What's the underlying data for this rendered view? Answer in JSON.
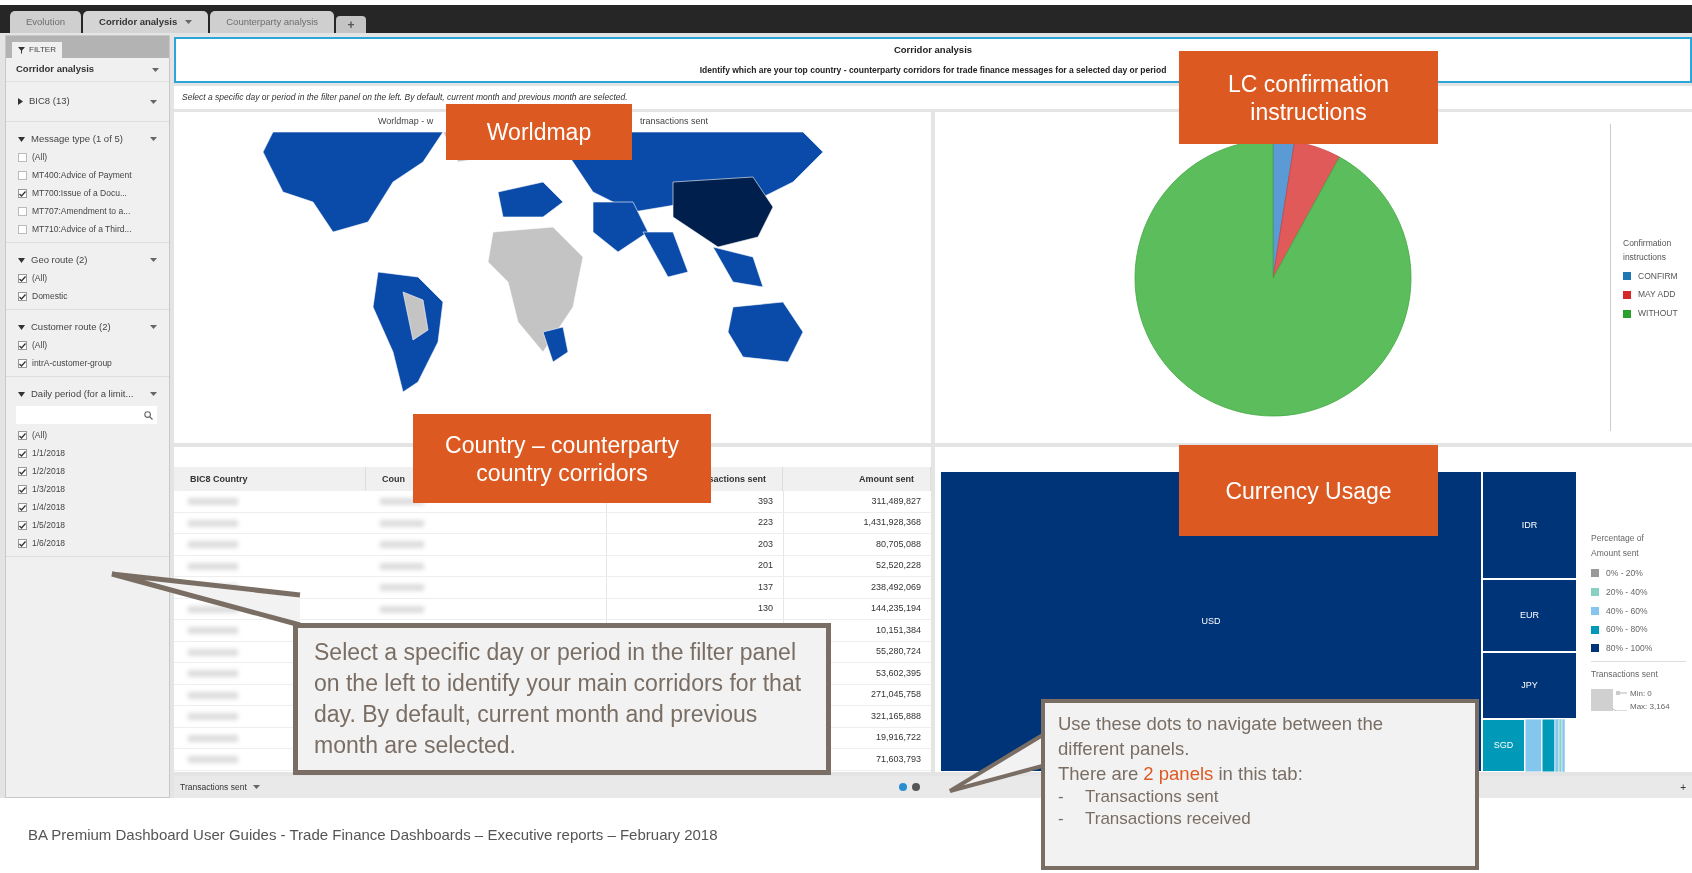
{
  "tabs": [
    {
      "label": "Evolution",
      "selected": false,
      "menu": false
    },
    {
      "label": "Corridor analysis",
      "selected": true,
      "menu": true
    },
    {
      "label": "Counterparty analysis",
      "selected": false,
      "menu": false
    }
  ],
  "add_tab": "+",
  "filter_panel": {
    "tab": "FILTER",
    "title": "Corridor analysis",
    "collapsed_section": "BIC8 (13)",
    "sections": [
      {
        "title": "Message type (1 of 5)",
        "search": false,
        "items": [
          {
            "label": "(All)",
            "checked": false
          },
          {
            "label": "MT400:Advice of Payment",
            "checked": false
          },
          {
            "label": "MT700:Issue of a Docu...",
            "checked": true
          },
          {
            "label": "MT707:Amendment to a...",
            "checked": false
          },
          {
            "label": "MT710:Advice of a Third...",
            "checked": false
          }
        ]
      },
      {
        "title": "Geo route (2)",
        "search": false,
        "items": [
          {
            "label": "(All)",
            "checked": true
          },
          {
            "label": "Domestic",
            "checked": true
          }
        ]
      },
      {
        "title": "Customer route (2)",
        "search": false,
        "items": [
          {
            "label": "(All)",
            "checked": true
          },
          {
            "label": "intrA-customer-group",
            "checked": true
          }
        ]
      },
      {
        "title": "Daily period (for a limit...",
        "search": true,
        "items": [
          {
            "label": "(All)",
            "checked": true
          },
          {
            "label": "1/1/2018",
            "checked": true
          },
          {
            "label": "1/2/2018",
            "checked": true
          },
          {
            "label": "1/3/2018",
            "checked": true
          },
          {
            "label": "1/4/2018",
            "checked": true
          },
          {
            "label": "1/5/2018",
            "checked": true
          },
          {
            "label": "1/6/2018",
            "checked": true
          }
        ]
      }
    ]
  },
  "header": {
    "title": "Corridor analysis",
    "description": "Identify which are your top country - counterparty corridors for trade finance messages for a selected day or period",
    "subtitle": "Select a specific day or period in the filter panel on the left. By default, current month and previous month are selected."
  },
  "map_panel": {
    "title_start": "Worldmap - w",
    "title_end": "transactions sent"
  },
  "pie_panel": {
    "legend_title": "Confirmation instructions",
    "legend": [
      {
        "label": "CONFIRM",
        "color": "#1f77b4"
      },
      {
        "label": "MAY ADD",
        "color": "#d62728"
      },
      {
        "label": "WITHOUT",
        "color": "#2ca02c"
      }
    ]
  },
  "table": {
    "columns": [
      "BIC8 Country",
      "Coun",
      "sactions sent",
      "Amount sent"
    ],
    "rows": [
      {
        "transactions": "393",
        "amount": "311,489,827"
      },
      {
        "transactions": "223",
        "amount": "1,431,928,368"
      },
      {
        "transactions": "203",
        "amount": "80,705,088"
      },
      {
        "transactions": "201",
        "amount": "52,520,228"
      },
      {
        "transactions": "137",
        "amount": "238,492,069"
      },
      {
        "transactions": "130",
        "amount": "144,235,194"
      },
      {
        "amount": "10,151,384"
      },
      {
        "amount": "55,280,724"
      },
      {
        "amount": "53,602,395"
      },
      {
        "amount": "271,045,758"
      },
      {
        "amount": "321,165,888"
      },
      {
        "amount": "19,916,722"
      },
      {
        "amount": "71,603,793"
      }
    ]
  },
  "treemap": {
    "cells": [
      {
        "label": "USD",
        "color": "#003478"
      },
      {
        "label": "IDR",
        "color": "#003478"
      },
      {
        "label": "EUR",
        "color": "#003478"
      },
      {
        "label": "JPY",
        "color": "#003478"
      },
      {
        "label": "SGD",
        "color": "#0099b8"
      }
    ],
    "legend_title": "Percentage of Amount sent",
    "legend": [
      {
        "label": "0% - 20%",
        "color": "#999999"
      },
      {
        "label": "20% - 40%",
        "color": "#88d0c4"
      },
      {
        "label": "40% - 60%",
        "color": "#85c6ef"
      },
      {
        "label": "60% - 80%",
        "color": "#0099b8"
      },
      {
        "label": "80% - 100%",
        "color": "#003478"
      }
    ],
    "size_title": "Transactions sent",
    "size_min": "Min: 0",
    "size_max": "Max: 3,164"
  },
  "bottom_bar": {
    "measure": "Transactions sent",
    "dots": [
      {
        "selected": true
      },
      {
        "selected": false
      }
    ],
    "add": "+"
  },
  "labels": [
    "Worldmap",
    "LC confirmation instructions",
    "Country – counterparty country corridors",
    "Currency Usage"
  ],
  "callout_filter": "Select a specific day or period in the filter panel on the left to identify your main corridors for that day. By default, current month and previous month are selected.",
  "callout_dots": {
    "intro": "Use these dots to navigate between the different panels.",
    "parts": [
      {
        "text": "There are ",
        "highlight": false
      },
      {
        "text": "2 panels",
        "highlight": true
      },
      {
        "text": " in this tab:",
        "highlight": false
      }
    ],
    "items": [
      {
        "bullet": "-",
        "text": "Transactions sent"
      },
      {
        "bullet": "-",
        "text": "Transactions received"
      }
    ]
  },
  "footer": "BA Premium Dashboard User Guides - Trade Finance Dashboards – Executive reports – February 2018"
}
